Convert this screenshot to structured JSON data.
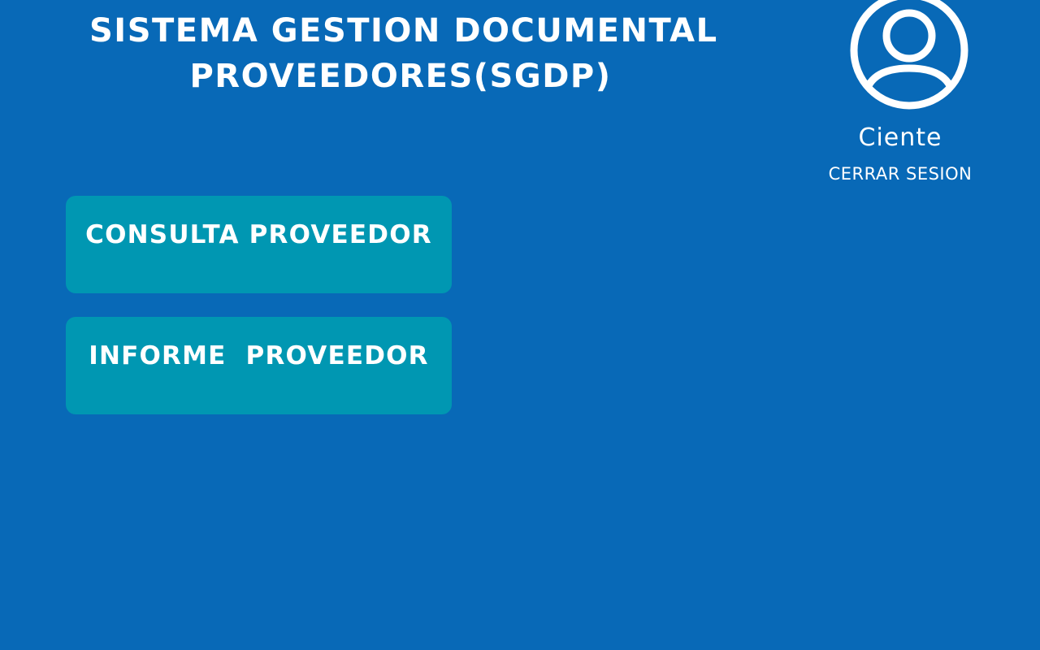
{
  "header": {
    "title_line1": "SISTEMA GESTION DOCUMENTAL",
    "title_line2": "PROVEEDORES(SGDP)"
  },
  "user": {
    "avatar_icon": "user-circle-icon",
    "name": "Ciente",
    "logout_label": "CERRAR SESION"
  },
  "menu": {
    "items": [
      {
        "label": "CONSULTA PROVEEDOR"
      },
      {
        "label": "INFORME  PROVEEDOR"
      }
    ]
  },
  "colors": {
    "background": "#0869b7",
    "button": "#0097b2",
    "text": "#ffffff"
  }
}
